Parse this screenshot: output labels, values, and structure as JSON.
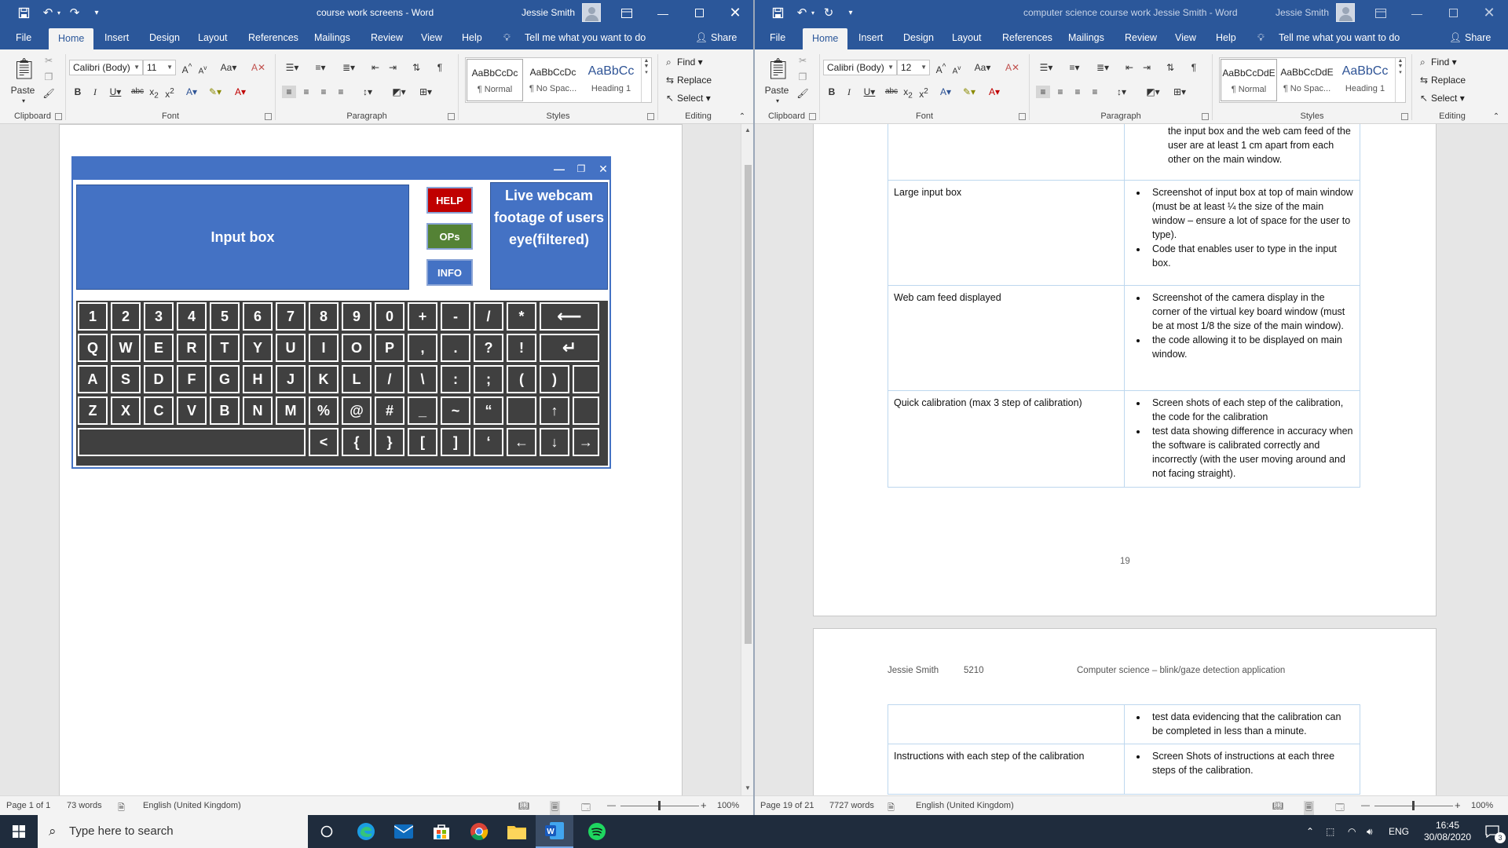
{
  "left_window": {
    "title": "course work screens  -  Word",
    "user": "Jessie Smith",
    "tabs": [
      "File",
      "Home",
      "Insert",
      "Design",
      "Layout",
      "References",
      "Mailings",
      "Review",
      "View",
      "Help"
    ],
    "tell_me": "Tell me what you want to do",
    "share": "Share",
    "font_name": "Calibri (Body)",
    "font_size": "11",
    "groups": {
      "clipboard": "Clipboard",
      "font": "Font",
      "paragraph": "Paragraph",
      "styles": "Styles",
      "editing": "Editing"
    },
    "paste": "Paste",
    "styles": [
      {
        "sample": "AaBbCcDc",
        "name": "¶ Normal"
      },
      {
        "sample": "AaBbCcDc",
        "name": "¶ No Spac..."
      },
      {
        "sample": "AaBbCc",
        "name": "Heading 1"
      }
    ],
    "editing": {
      "find": "Find",
      "replace": "Replace",
      "select": "Select"
    },
    "keyboard": {
      "input_box": "Input box",
      "help": "HELP",
      "ops": "OPs",
      "info": "INFO",
      "webcam": "Live webcam footage of users eye(filtered)",
      "row1": [
        "1",
        "2",
        "3",
        "4",
        "5",
        "6",
        "7",
        "8",
        "9",
        "0",
        "+",
        "-",
        "/",
        "*",
        "⟵"
      ],
      "row2": [
        "Q",
        "W",
        "E",
        "R",
        "T",
        "Y",
        "U",
        "I",
        "O",
        "P",
        ",",
        ".",
        "?",
        "!",
        "↵"
      ],
      "row3": [
        "A",
        "S",
        "D",
        "F",
        "G",
        "H",
        "J",
        "K",
        "L",
        "/",
        "\\",
        ":",
        ";",
        "(",
        ")"
      ],
      "row4": [
        "Z",
        "X",
        "C",
        "V",
        "B",
        "N",
        "M",
        "%",
        "@",
        "#",
        "_",
        "~",
        "“",
        "",
        "↑",
        ""
      ],
      "row5": [
        "",
        "<",
        "{",
        "}",
        "[",
        "]",
        "‘",
        "←",
        "↓",
        "→"
      ]
    },
    "status": {
      "page": "Page 1 of 1",
      "words": "73 words",
      "language": "English (United Kingdom)",
      "zoom": "100%"
    }
  },
  "right_window": {
    "title": "computer science course work Jessie Smith  -  Word",
    "user": "Jessie Smith",
    "tabs": [
      "File",
      "Home",
      "Insert",
      "Design",
      "Layout",
      "References",
      "Mailings",
      "Review",
      "View",
      "Help"
    ],
    "tell_me": "Tell me what you want to do",
    "share": "Share",
    "font_name": "Calibri (Body)",
    "font_size": "12",
    "groups": {
      "clipboard": "Clipboard",
      "font": "Font",
      "paragraph": "Paragraph",
      "styles": "Styles",
      "editing": "Editing"
    },
    "paste": "Paste",
    "styles": [
      {
        "sample": "AaBbCcDdE",
        "name": "¶ Normal"
      },
      {
        "sample": "AaBbCcDdE",
        "name": "¶ No Spac..."
      },
      {
        "sample": "AaBbCc",
        "name": "Heading 1"
      }
    ],
    "editing": {
      "find": "Find",
      "replace": "Replace",
      "select": "Select"
    },
    "page19_rows": [
      {
        "left": "",
        "items": [
          "windows evidencing that the buttons (settings, info and phrase), the keyboard, the input box and the web cam feed of the user are at least 1 cm apart from each other on the main window."
        ],
        "bullet": false
      },
      {
        "left": "Large input box",
        "items": [
          "Screenshot of input box at top of main window (must be at least ¼ the size of the main window – ensure a lot of space for the user to type).",
          "Code that enables user to type in the input box."
        ],
        "bullet": true
      },
      {
        "left": "Web cam feed displayed",
        "items": [
          "Screenshot of the camera display in the corner of the virtual key board window (must be at most 1/8 the size of the main window).",
          "the code allowing it to be displayed on main window."
        ],
        "bullet": true
      },
      {
        "left": "Quick calibration (max 3 step of calibration)",
        "items": [
          "Screen shots of each step of the calibration, the code for the calibration",
          "test data showing difference in accuracy when the software is calibrated correctly and incorrectly (with the user moving around and not facing straight)."
        ],
        "bullet": true
      }
    ],
    "page_number": "19",
    "header": {
      "name": "Jessie Smith",
      "number": "5210",
      "subject": "Computer science – blink/gaze detection application"
    },
    "page20_rows": [
      {
        "left": "",
        "items": [
          "test data evidencing that the calibration can be completed in less than a minute."
        ]
      },
      {
        "left": "Instructions with each step of the calibration",
        "items": [
          "Screen Shots of instructions at each three steps of the calibration."
        ]
      }
    ],
    "status": {
      "page": "Page 19 of 21",
      "words": "7727 words",
      "language": "English (United Kingdom)",
      "zoom": "100%"
    }
  },
  "taskbar": {
    "search_placeholder": "Type here to search",
    "lang": "ENG",
    "time": "16:45",
    "date": "30/08/2020",
    "notif_count": "3"
  },
  "colors": {
    "word_blue": "#2b579a",
    "vk_blue": "#4472c4",
    "help_red": "#c00000",
    "ops_green": "#548235",
    "key_dark": "#404040"
  }
}
